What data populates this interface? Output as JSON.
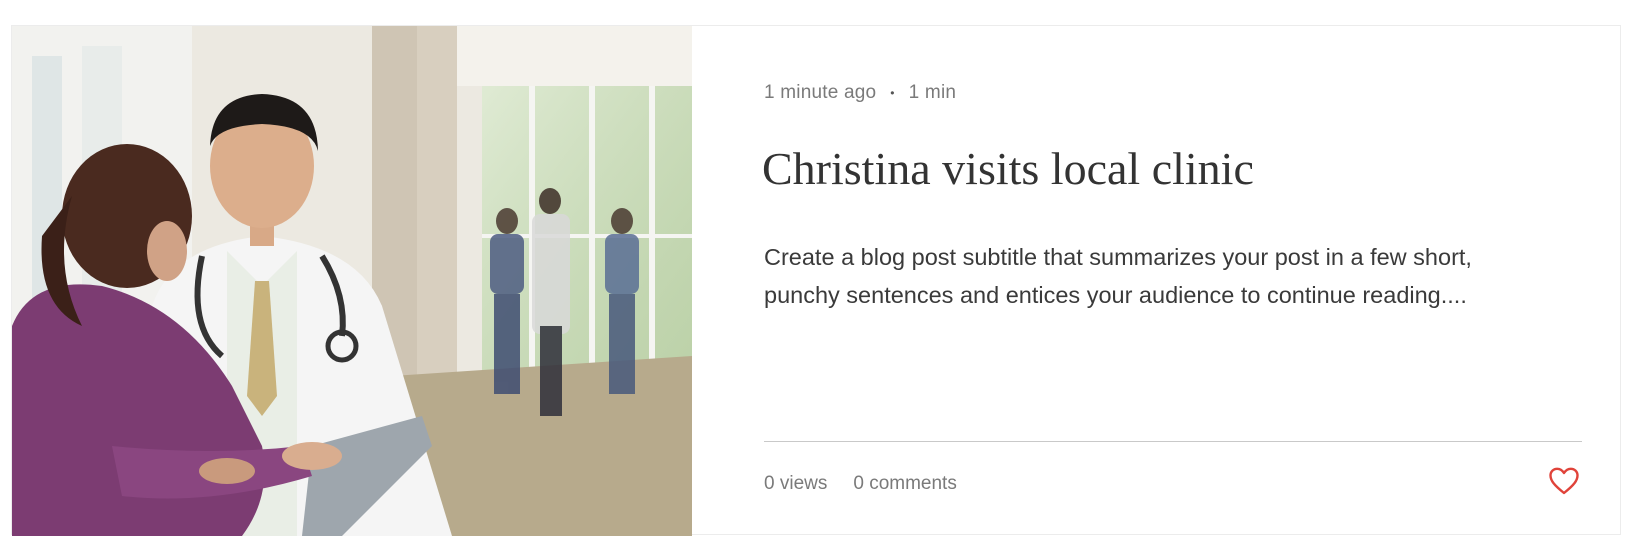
{
  "post": {
    "published": "1 minute ago",
    "separator": "•",
    "read_time": "1 min",
    "title": "Christina visits local clinic",
    "excerpt": "Create a blog post subtitle that summarizes your post in a few short, punchy sentences and entices your audience to continue reading....",
    "views": "0 views",
    "comments": "0 comments"
  },
  "icons": {
    "like": "heart-icon"
  },
  "colors": {
    "heart": "#e0433a",
    "title": "#333333",
    "meta": "#7a7a7a"
  }
}
